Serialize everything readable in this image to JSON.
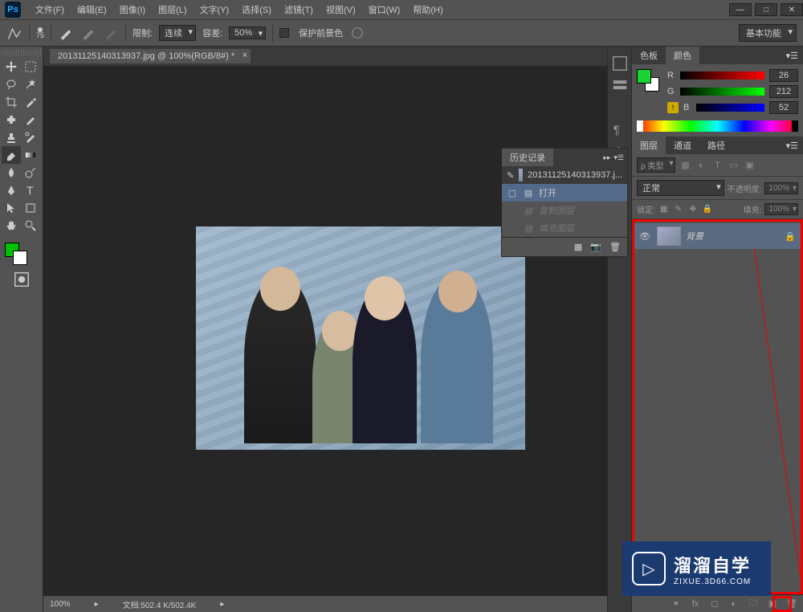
{
  "menubar": {
    "items": [
      "文件(F)",
      "编辑(E)",
      "图像(I)",
      "图层(L)",
      "文字(Y)",
      "选择(S)",
      "滤镜(T)",
      "视图(V)",
      "窗口(W)",
      "帮助(H)"
    ]
  },
  "optionsbar": {
    "brush_size": "75",
    "limit_label": "限制:",
    "limit_value": "连续",
    "tolerance_label": "容差:",
    "tolerance_value": "50%",
    "protect_label": "保护前景色",
    "workspace": "基本功能"
  },
  "doc_tab": {
    "title": "20131125140313937.jpg @ 100%(RGB/8#) *"
  },
  "history_panel": {
    "title": "历史记录",
    "doc_name": "20131125140313937.j...",
    "items": [
      {
        "label": "打开",
        "active": true
      },
      {
        "label": "复制图层",
        "dim": true
      },
      {
        "label": "填充图层",
        "dim": true
      }
    ]
  },
  "color_panel": {
    "tabs": [
      "色板",
      "颜色"
    ],
    "active_tab": 1,
    "r_label": "R",
    "r_value": "26",
    "g_label": "G",
    "g_value": "212",
    "b_label": "B",
    "b_value": "52",
    "fg_color": "#1ad434"
  },
  "layers_panel": {
    "tabs": [
      "图层",
      "通道",
      "路径"
    ],
    "active_tab": 0,
    "filter_label": "ρ 类型",
    "blend_mode": "正常",
    "opacity_label": "不透明度:",
    "opacity_value": "100%",
    "lock_label": "锁定:",
    "fill_label": "填充:",
    "fill_value": "100%",
    "layers": [
      {
        "name": "背景",
        "locked": true
      }
    ]
  },
  "statusbar": {
    "zoom": "100%",
    "doc_info": "文档:502.4 K/502.4K"
  },
  "watermark": {
    "main": "溜溜自学",
    "sub": "ZIXUE.3D66.COM"
  }
}
